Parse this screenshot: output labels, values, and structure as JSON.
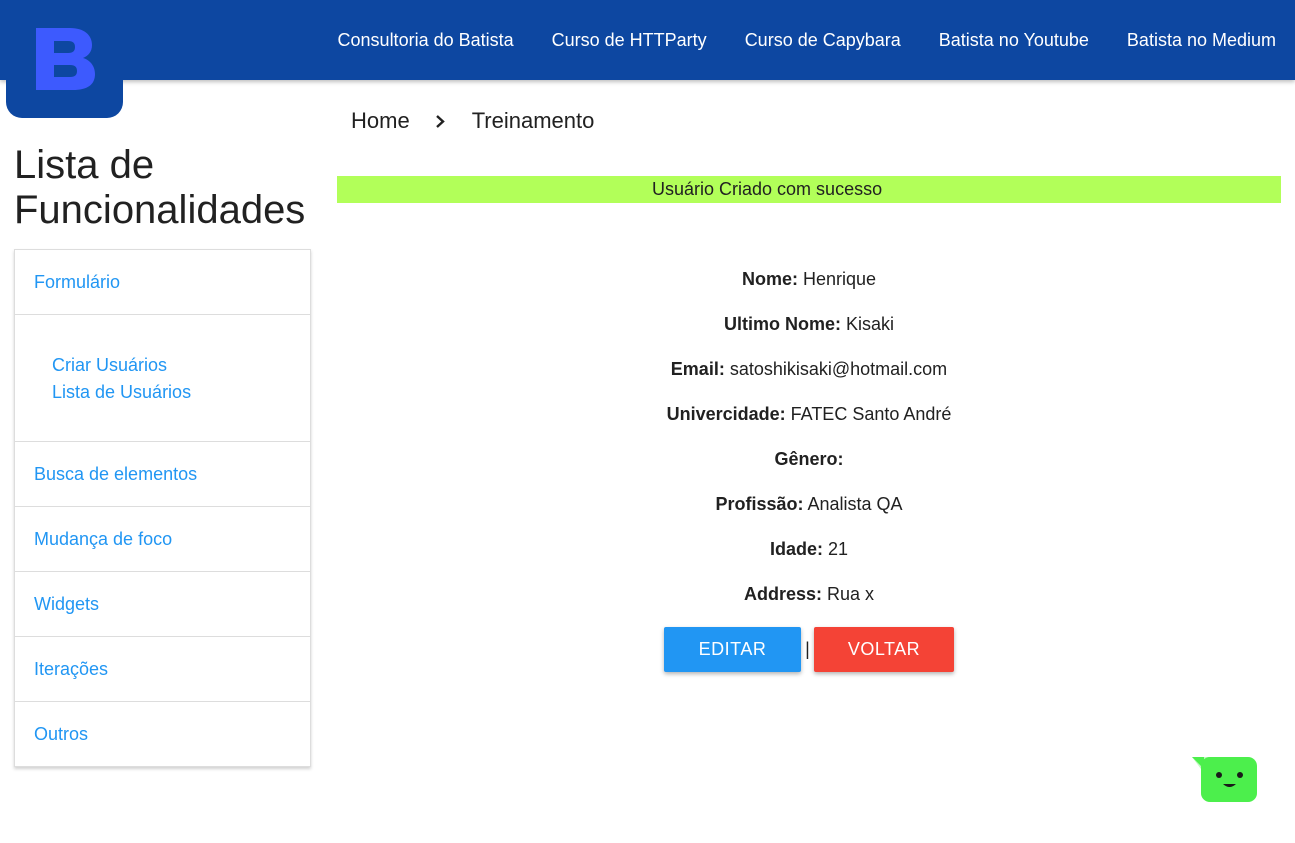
{
  "logo": {
    "letter": "B",
    "bg": "#0d47a1",
    "letter_color": "#3d5afe"
  },
  "topnav": {
    "items": [
      "Consultoria do Batista",
      "Curso de HTTParty",
      "Curso de Capybara",
      "Batista no Youtube",
      "Batista no Medium"
    ]
  },
  "sidebar": {
    "title_line1": "Lista de",
    "title_line2": "Funcionalidades",
    "items": {
      "formulario": "Formulário",
      "sub": [
        "Criar Usuários",
        "Lista de Usuários"
      ],
      "busca": "Busca de elementos",
      "mudanca": "Mudança de foco",
      "widgets": "Widgets",
      "iteracoes": "Iterações",
      "outros": "Outros"
    }
  },
  "breadcrumb": {
    "home": "Home",
    "current": "Treinamento",
    "separator_icon": "chevron-right-icon"
  },
  "alert": {
    "message": "Usuário Criado com sucesso",
    "color": "#b2ff59"
  },
  "user": {
    "fields": [
      {
        "label": "Nome:",
        "value": " Henrique"
      },
      {
        "label": "Ultimo Nome:",
        "value": " Kisaki"
      },
      {
        "label": "Email:",
        "value": " satoshikisaki@hotmail.com"
      },
      {
        "label": "Univercidade:",
        "value": " FATEC Santo André"
      },
      {
        "label": "Gênero:",
        "value": ""
      },
      {
        "label": "Profissão:",
        "value": " Analista QA"
      },
      {
        "label": "Idade:",
        "value": " 21"
      },
      {
        "label": "Address:",
        "value": " Rua x"
      }
    ]
  },
  "actions": {
    "edit": "EDITAR",
    "divider": "|",
    "back": "VOLTAR"
  },
  "chat": {
    "icon": "chat-bot-icon",
    "color": "#4cef4c"
  }
}
